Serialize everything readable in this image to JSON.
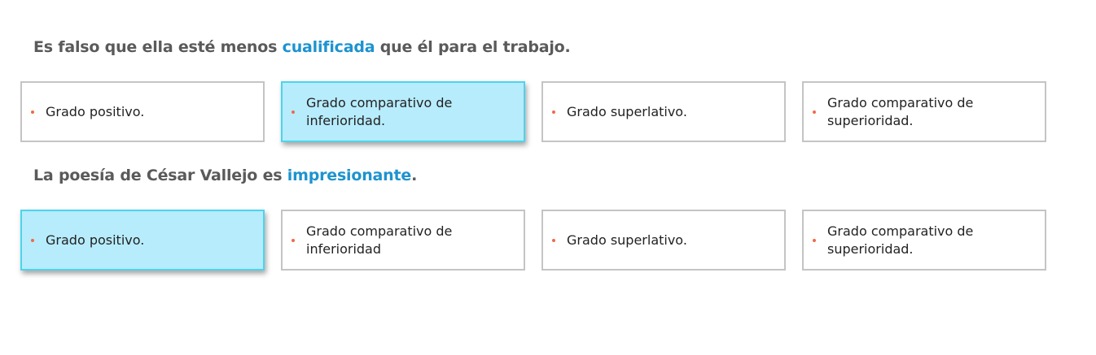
{
  "questions": [
    {
      "text_before": "Es falso que ella esté menos ",
      "highlight": "cualificada",
      "text_after": " que él para el trabajo.",
      "options": [
        {
          "label": "Grado positivo.",
          "selected": false
        },
        {
          "label": "Grado comparativo de inferioridad.",
          "selected": true
        },
        {
          "label": "Grado superlativo.",
          "selected": false
        },
        {
          "label": "Grado comparativo de superioridad.",
          "selected": false
        }
      ]
    },
    {
      "text_before": "La poesía de César Vallejo es ",
      "highlight": "impresionante",
      "text_after": ".",
      "options": [
        {
          "label": "Grado positivo.",
          "selected": true
        },
        {
          "label": "Grado comparativo de inferioridad",
          "selected": false
        },
        {
          "label": "Grado superlativo.",
          "selected": false
        },
        {
          "label": "Grado comparativo de superioridad.",
          "selected": false
        }
      ]
    }
  ],
  "colors": {
    "highlight": "#1d93cf",
    "question_text": "#5a5a5a",
    "selected_bg": "#b7ecfc",
    "selected_border": "#4cd4ec",
    "bullet": "#ee6a4a",
    "option_border": "#c4c4c4"
  }
}
